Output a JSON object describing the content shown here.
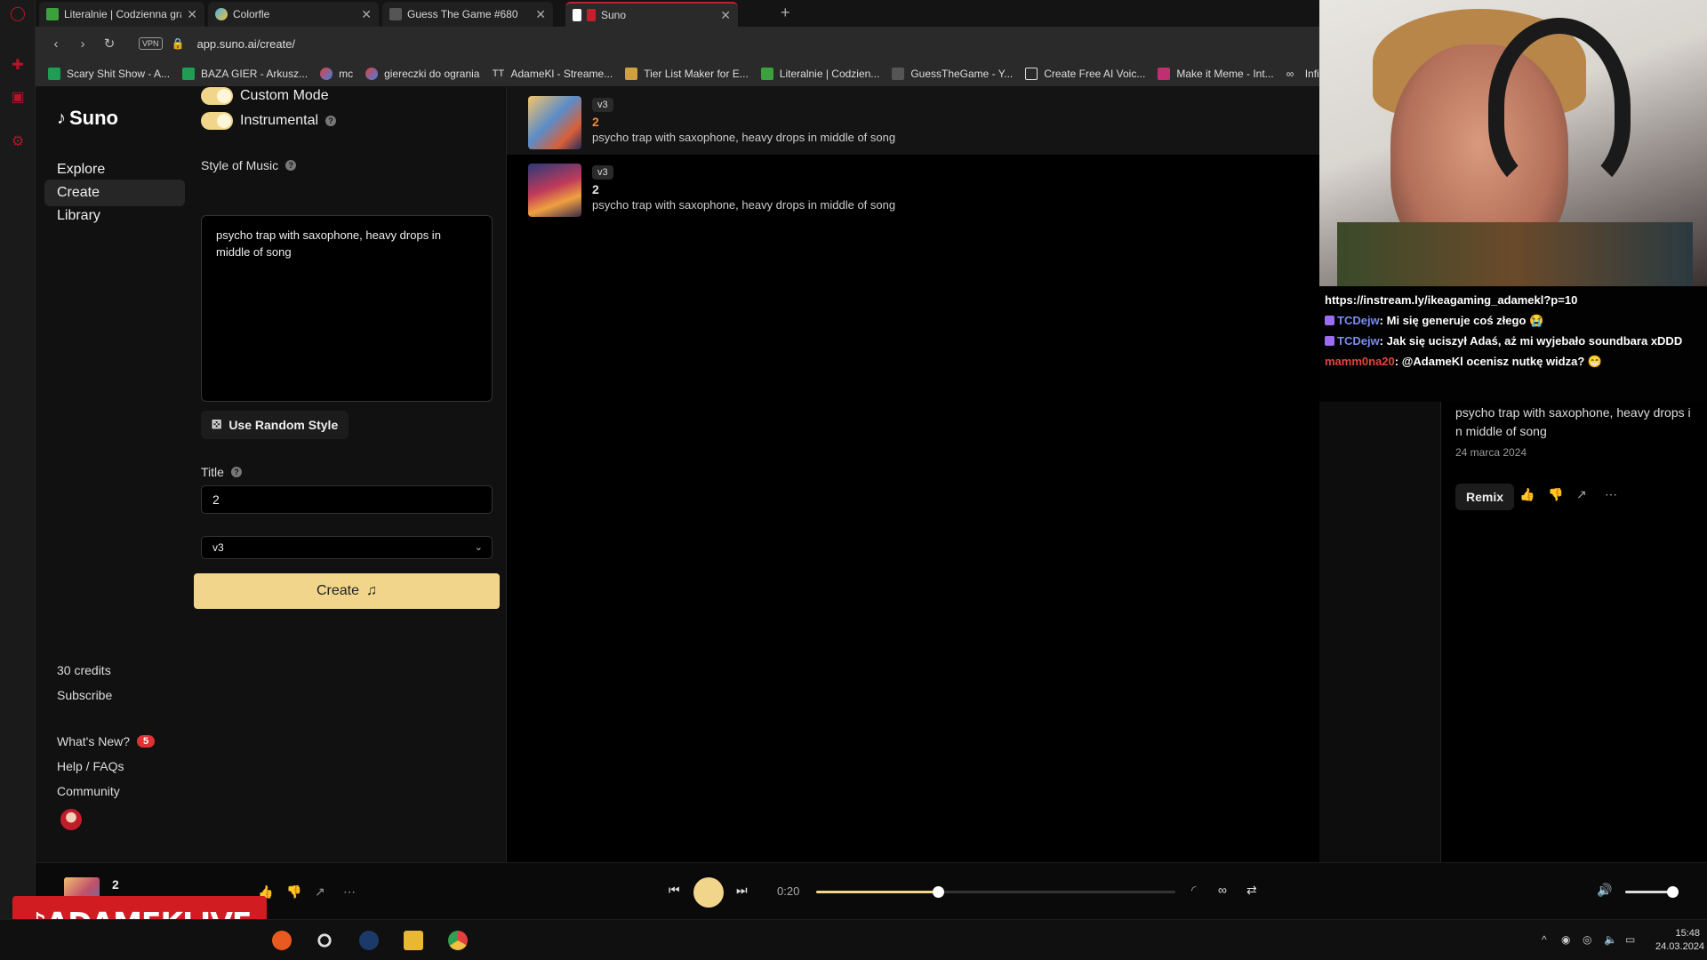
{
  "browser": {
    "tabs": [
      {
        "label": "Literalnie | Codzienna gra"
      },
      {
        "label": "Colorfle"
      },
      {
        "label": "Guess The Game #680"
      },
      {
        "label": "Suno"
      }
    ],
    "url": "app.suno.ai/create/",
    "vpn_label": "VPN",
    "bookmarks": [
      "Scary Shit Show - A...",
      "BAZA GIER - Arkusz...",
      "mc",
      "giereczki do ogrania",
      "AdameKl - Streame...",
      "Tier List Maker for E...",
      "Literalnie | Codzien...",
      "GuessTheGame - Y...",
      "Create Free AI Voic...",
      "Make it Meme - Int...",
      "Infinit"
    ]
  },
  "suno": {
    "logo": "Suno",
    "nav": [
      "Explore",
      "Create",
      "Library"
    ],
    "credits": "30 credits",
    "subscribe": "Subscribe",
    "whats_new": "What's New?",
    "whats_new_count": "5",
    "help": "Help / FAQs",
    "community": "Community"
  },
  "create_form": {
    "custom_mode": "Custom Mode",
    "instrumental": "Instrumental",
    "style_label": "Style of Music",
    "style_value": "psycho trap with saxophone, heavy drops in middle of song",
    "random_style": "Use Random Style",
    "title_label": "Title",
    "title_value": "2",
    "model": "v3",
    "create_button": "Create"
  },
  "clips": [
    {
      "version": "v3",
      "title": "2",
      "desc": "psycho trap with saxophone, heavy drops in middle of song"
    },
    {
      "version": "v3",
      "title": "2",
      "desc": "psycho trap with saxophone, heavy drops in middle of song"
    }
  ],
  "chat": {
    "link": "https://instream.ly/ikeagaming_adamekl?p=10",
    "messages": [
      {
        "user": "TCDejw",
        "text": "Mi się generuje coś złego 😭"
      },
      {
        "user": "TCDejw",
        "text": "Jak się uciszył Adaś, aż mi wyjebało soundbara xDDD"
      },
      {
        "user": "mamm0na20",
        "text": "@AdameKl ocenisz nutkę widza? 😁"
      }
    ]
  },
  "detail": {
    "desc": "psycho trap with saxophone, heavy drops i n middle of song",
    "date": "24 marca 2024",
    "remix": "Remix"
  },
  "player": {
    "title": "2",
    "time": "0:20",
    "progress_fraction": 0.34,
    "volume_fraction": 1.0
  },
  "overlay": {
    "brand": "ADAMEKLIVE"
  },
  "taskbar": {
    "time": "15:48",
    "date": "24.03.2024"
  },
  "colors": {
    "accent": "#f0d58a",
    "clip_title": "#f08b3c",
    "brand_red": "#d11c22"
  }
}
